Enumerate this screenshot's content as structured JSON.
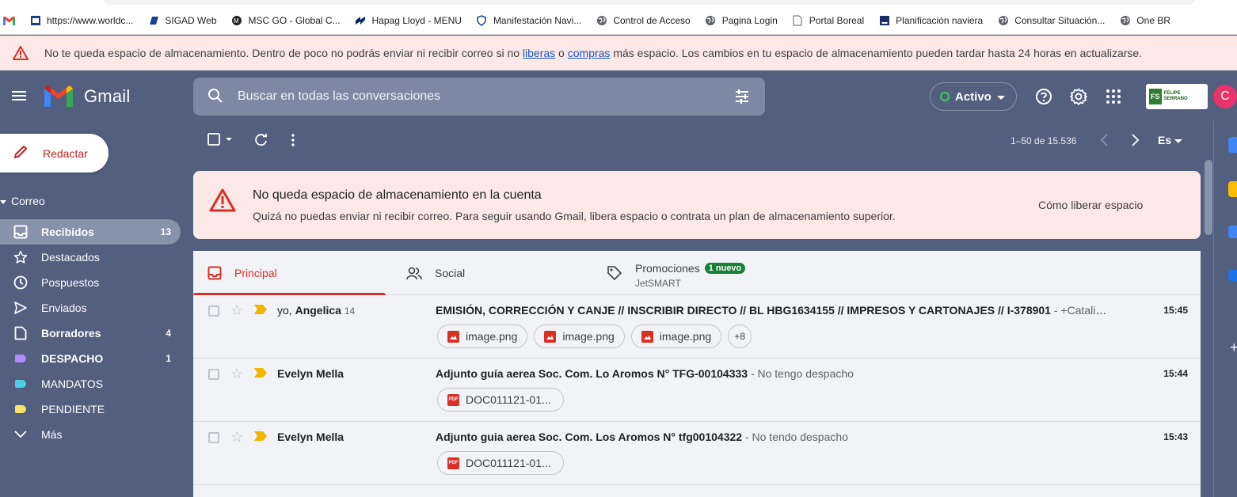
{
  "bookmarks": [
    {
      "label": "",
      "icon": "gmail-icon"
    },
    {
      "label": "https://www.worldc...",
      "icon": "page-icon"
    },
    {
      "label": "SIGAD Web",
      "icon": "sigad-icon"
    },
    {
      "label": "MSC GO - Global C...",
      "icon": "msc-icon"
    },
    {
      "label": "Hapag Lloyd - MENU",
      "icon": "hapag-icon"
    },
    {
      "label": "Manifestación Navi...",
      "icon": "shield-icon"
    },
    {
      "label": "Control de Acceso",
      "icon": "globe-icon"
    },
    {
      "label": "Pagina Login",
      "icon": "globe-icon"
    },
    {
      "label": "Portal Boreal",
      "icon": "doc-icon"
    },
    {
      "label": "Planificación naviera",
      "icon": "ship-icon"
    },
    {
      "label": "Consultar Situación...",
      "icon": "globe-icon"
    },
    {
      "label": "One BR",
      "icon": "globe-icon"
    }
  ],
  "banner": {
    "text_before": "No te queda espacio de almacenamiento. Dentro de poco no podrás enviar ni recibir correo si no ",
    "link1": "liberas",
    "text_mid": " o ",
    "link2": "compras",
    "text_after": " más espacio. Los cambios en tu espacio de almacenamiento pueden tardar hasta 24 horas en actualizarse."
  },
  "header": {
    "app_name": "Gmail",
    "search_placeholder": "Buscar en todas las conversaciones",
    "status": "Activo",
    "avatar_letter": "C",
    "org_logo_text": "FELIPE SERRANO"
  },
  "sidebar": {
    "compose": "Redactar",
    "section": "Correo",
    "items": [
      {
        "label": "Recibidos",
        "count": "13",
        "icon": "inbox-icon",
        "active": true
      },
      {
        "label": "Destacados",
        "count": "",
        "icon": "star-icon"
      },
      {
        "label": "Pospuestos",
        "count": "",
        "icon": "clock-icon"
      },
      {
        "label": "Enviados",
        "count": "",
        "icon": "send-icon"
      },
      {
        "label": "Borradores",
        "count": "4",
        "icon": "draft-icon"
      },
      {
        "label": "DESPACHO",
        "count": "1",
        "icon": "label-icon",
        "color": "#b388ff"
      },
      {
        "label": "MANDATOS",
        "count": "",
        "icon": "label-icon",
        "color": "#4dd0e1"
      },
      {
        "label": "PENDIENTE",
        "count": "",
        "icon": "label-icon",
        "color": "#ffe066"
      },
      {
        "label": "Más",
        "count": "",
        "icon": "chevron-down-icon"
      }
    ]
  },
  "toolbar": {
    "pager": "1–50 de 15.536",
    "lang": "Es"
  },
  "quota": {
    "title": "No queda espacio de almacenamiento en la cuenta",
    "subtitle": "Quizá no puedas enviar ni recibir correo. Para seguir usando Gmail, libera espacio o contrata un plan de almacenamiento superior.",
    "link": "Cómo liberar espacio"
  },
  "tabs": [
    {
      "label": "Principal",
      "active": true
    },
    {
      "label": "Social"
    },
    {
      "label": "Promociones",
      "badge": "1 nuevo",
      "sub": "JetSMART"
    }
  ],
  "emails": [
    {
      "sender_prefix": "yo, ",
      "sender": "Angelica",
      "count": "14",
      "subject": "EMISIÓN, CORRECCIÓN Y CANJE // INSCRIBIR DIRECTO // BL HBG1634155 // IMPRESOS Y CARTONAJES // I-378901",
      "snippet": " - +Catalina L...",
      "time": "15:45",
      "attachments": [
        {
          "name": "image.png",
          "type": "img"
        },
        {
          "name": "image.png",
          "type": "img"
        },
        {
          "name": "image.png",
          "type": "img"
        }
      ],
      "more": "+8"
    },
    {
      "sender_prefix": "",
      "sender": "Evelyn Mella",
      "count": "",
      "subject": "Adjunto guía aerea Soc. Com. Lo Aromos N° TFG-00104333",
      "snippet": " - No tengo despacho",
      "time": "15:44",
      "attachments": [
        {
          "name": "DOC011121-01...",
          "type": "pdf"
        }
      ],
      "more": ""
    },
    {
      "sender_prefix": "",
      "sender": "Evelyn Mella",
      "count": "",
      "subject": "Adjunto guia aerea Soc. Com. Los Aromos N° tfg00104322",
      "snippet": " - No tendo despacho",
      "time": "15:43",
      "attachments": [
        {
          "name": "DOC011121-01...",
          "type": "pdf"
        }
      ],
      "more": ""
    }
  ]
}
